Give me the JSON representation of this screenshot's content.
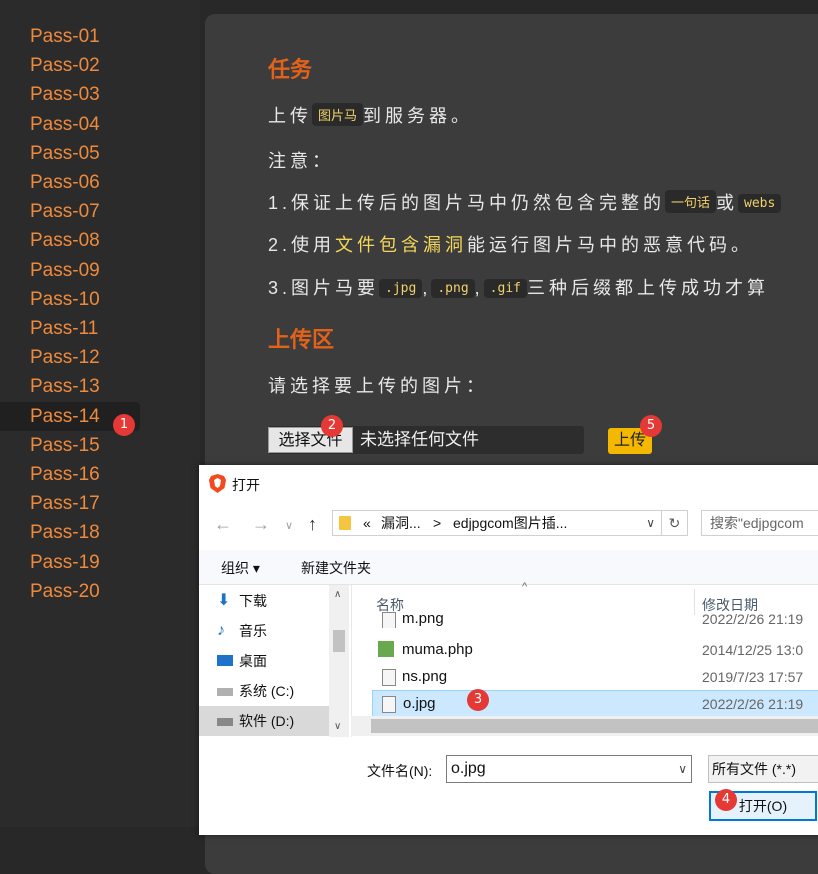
{
  "sidebar": {
    "items": [
      "Pass-01",
      "Pass-02",
      "Pass-03",
      "Pass-04",
      "Pass-05",
      "Pass-06",
      "Pass-07",
      "Pass-08",
      "Pass-09",
      "Pass-10",
      "Pass-11",
      "Pass-12",
      "Pass-13",
      "Pass-14",
      "Pass-15",
      "Pass-16",
      "Pass-17",
      "Pass-18",
      "Pass-19",
      "Pass-20"
    ],
    "active": "Pass-14"
  },
  "task": {
    "title": "任务",
    "line1_pre": "上传",
    "line1_code": "图片马",
    "line1_post": "到服务器。",
    "note": "注意：",
    "item1_pre": "1.保证上传后的图片马中仍然包含完整的",
    "item1_code": "一句话",
    "item1_mid": "或",
    "item1_code2": "webs",
    "item2_pre": "2.使用",
    "item2_hl": "文件包含漏洞",
    "item2_post": "能运行图片马中的恶意代码。",
    "item3_pre": "3.图片马要",
    "item3_code1": ".jpg",
    "item3_sep1": ",",
    "item3_code2": ".png",
    "item3_sep2": ",",
    "item3_code3": ".gif",
    "item3_post": "三种后缀都上传成功才算"
  },
  "upload": {
    "title": "上传区",
    "prompt": "请选择要上传的图片：",
    "choose_button": "选择文件",
    "no_file": "未选择任何文件",
    "submit_button": "上传"
  },
  "badges": [
    "1",
    "2",
    "3",
    "4",
    "5"
  ],
  "dialog": {
    "title": "打开",
    "path_prefix": "«",
    "path_part1": "漏洞...",
    "path_sep": ">",
    "path_part2": "edjpgcom图片插...",
    "search_placeholder": "搜索\"edjpgcom",
    "organize": "组织 ▾",
    "new_folder": "新建文件夹",
    "nav_items": [
      "下载",
      "音乐",
      "桌面",
      "系统 (C:)",
      "软件 (D:)"
    ],
    "col_name": "名称",
    "col_date": "修改日期",
    "files": [
      {
        "name": "m.png",
        "date": "2022/2/26 21:19"
      },
      {
        "name": "muma.php",
        "date": "2014/12/25 13:0"
      },
      {
        "name": "ns.png",
        "date": "2019/7/23 17:57"
      },
      {
        "name": "o.jpg",
        "date": "2022/2/26 21:19"
      }
    ],
    "selected_file": "o.jpg",
    "filename_label": "文件名(N):",
    "filename_value": "o.jpg",
    "filetype": "所有文件 (*.*)",
    "open_button": "打开(O)"
  },
  "colors": {
    "accent": "#ef8a3c",
    "heading": "#e2621a",
    "badge": "#e53935",
    "upload": "#f5b800"
  }
}
